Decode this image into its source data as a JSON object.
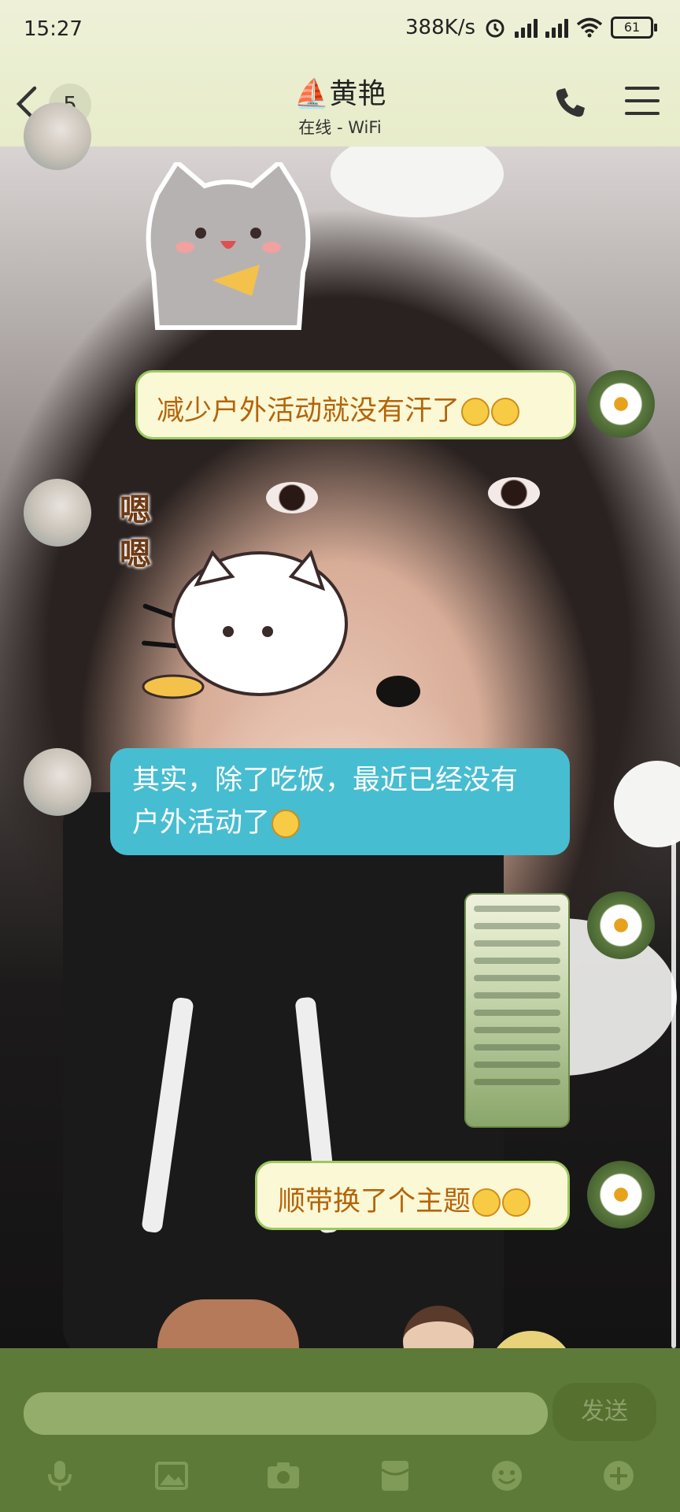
{
  "status_bar": {
    "time": "15:27",
    "net_speed": "388K/s",
    "battery": "61"
  },
  "header": {
    "unread_count": "5",
    "title": "⛵黄艳",
    "subtitle": "在线 - WiFi"
  },
  "messages": [
    {
      "side": "right",
      "type": "text",
      "text": "减少户外活动就没有汗了",
      "bubble": "yellow"
    },
    {
      "side": "left",
      "type": "sticker",
      "text": "嗯嗯"
    },
    {
      "side": "left",
      "type": "text",
      "text_line1": "其实，除了吃饭，最近已经没有",
      "text_line2": "户外活动了",
      "bubble": "blue"
    },
    {
      "side": "right",
      "type": "image",
      "text": ""
    },
    {
      "side": "right",
      "type": "text",
      "text": "顺带换了个主题",
      "bubble": "yellow"
    }
  ],
  "composer": {
    "input_value": "",
    "send_label": "发送",
    "tools": [
      "mic-icon",
      "image-icon",
      "camera-icon",
      "red-packet-icon",
      "emoji-icon",
      "plus-icon"
    ]
  },
  "colors": {
    "header_bg": "#e7ecc9",
    "composer_bg": "#5e7a38",
    "bubble_yellow": "#fbf8d6",
    "bubble_blue": "#47bdd1",
    "yellow_text": "#b4640a"
  }
}
